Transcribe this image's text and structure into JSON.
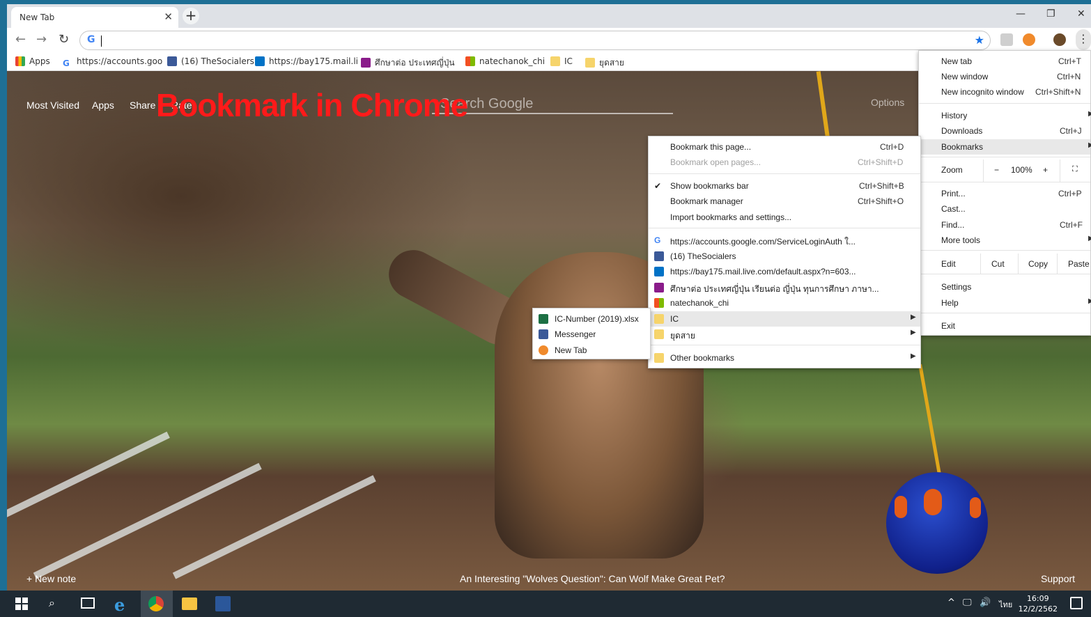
{
  "tab": {
    "title": "New Tab"
  },
  "bookmarks_bar": [
    {
      "label": "Apps"
    },
    {
      "label": "https://accounts.goo"
    },
    {
      "label": "(16) TheSocialers"
    },
    {
      "label": "https://bay175.mail.li"
    },
    {
      "label": "ศึกษาต่อ ประเทศญี่ปุ่น"
    },
    {
      "label": "natechanok_chi"
    },
    {
      "label": "IC"
    },
    {
      "label": "ยุดสาย"
    }
  ],
  "page": {
    "links": [
      "Most Visited",
      "Apps",
      "Share",
      "Rate"
    ],
    "search_placeholder": "Search Google",
    "options": "Options",
    "overlay_title": "Bookmark in Chrome",
    "new_note": "+ New note",
    "caption": "An Interesting \"Wolves Question\": Can Wolf Make Great Pet?",
    "support": "Support"
  },
  "chrome_menu": {
    "items": [
      {
        "label": "New tab",
        "shortcut": "Ctrl+T"
      },
      {
        "label": "New window",
        "shortcut": "Ctrl+N"
      },
      {
        "label": "New incognito window",
        "shortcut": "Ctrl+Shift+N"
      },
      {
        "label": "History",
        "shortcut": ""
      },
      {
        "label": "Downloads",
        "shortcut": "Ctrl+J"
      },
      {
        "label": "Bookmarks",
        "shortcut": ""
      },
      {
        "label": "Print...",
        "shortcut": "Ctrl+P"
      },
      {
        "label": "Cast...",
        "shortcut": ""
      },
      {
        "label": "Find...",
        "shortcut": "Ctrl+F"
      },
      {
        "label": "More tools",
        "shortcut": ""
      },
      {
        "label": "Settings",
        "shortcut": ""
      },
      {
        "label": "Help",
        "shortcut": ""
      },
      {
        "label": "Exit",
        "shortcut": ""
      }
    ],
    "zoom": {
      "label": "Zoom",
      "minus": "−",
      "value": "100%",
      "plus": "+"
    },
    "edit": {
      "label": "Edit",
      "cut": "Cut",
      "copy": "Copy",
      "paste": "Paste"
    }
  },
  "bookmarks_menu": {
    "items": [
      {
        "label": "Bookmark this page...",
        "shortcut": "Ctrl+D"
      },
      {
        "label": "Bookmark open pages...",
        "shortcut": "Ctrl+Shift+D"
      },
      {
        "label": "Show bookmarks bar",
        "shortcut": "Ctrl+Shift+B"
      },
      {
        "label": "Bookmark manager",
        "shortcut": "Ctrl+Shift+O"
      },
      {
        "label": "Import bookmarks and settings...",
        "shortcut": ""
      },
      {
        "label": "https://accounts.google.com/ServiceLoginAuth ใ...",
        "shortcut": ""
      },
      {
        "label": "(16) TheSocialers",
        "shortcut": ""
      },
      {
        "label": "https://bay175.mail.live.com/default.aspx?n=603...",
        "shortcut": ""
      },
      {
        "label": "ศึกษาต่อ ประเทศญี่ปุ่น เรียนต่อ ญี่ปุ่น ทุนการศึกษา ภาษา...",
        "shortcut": ""
      },
      {
        "label": "natechanok_chi",
        "shortcut": ""
      },
      {
        "label": "IC",
        "shortcut": ""
      },
      {
        "label": "ยุดสาย",
        "shortcut": ""
      },
      {
        "label": "Other bookmarks",
        "shortcut": ""
      }
    ]
  },
  "ic_submenu": {
    "items": [
      {
        "label": "IC-Number (2019).xlsx"
      },
      {
        "label": "Messenger"
      },
      {
        "label": "New Tab"
      }
    ]
  },
  "taskbar": {
    "time": "16:09",
    "date": "12/2/2562",
    "lang": "ไทย"
  },
  "colors": {
    "accent": "#1a73e8",
    "overlay_red": "#ff1a1a",
    "slide_blue": "#1e6f95"
  }
}
